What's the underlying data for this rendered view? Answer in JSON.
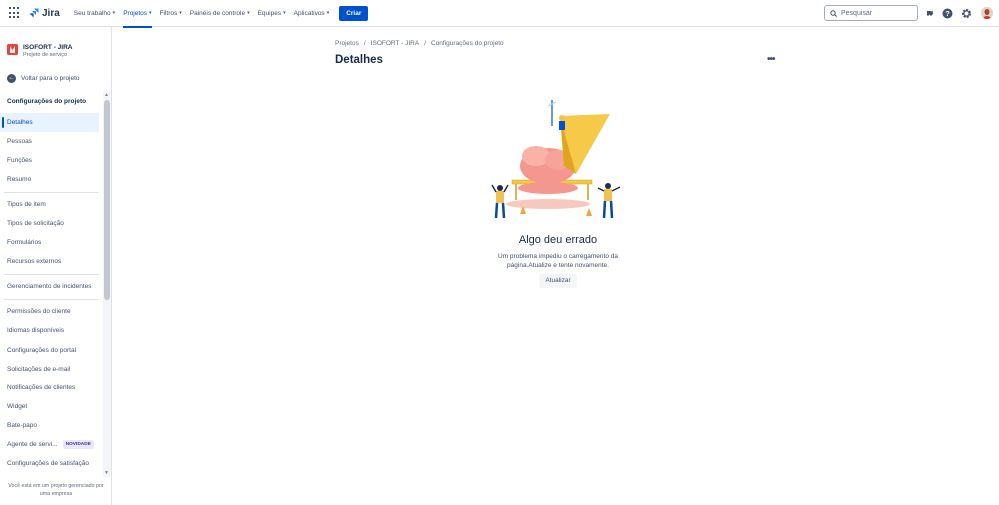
{
  "topnav": {
    "logo_text": "Jira",
    "items": [
      {
        "label": "Seu trabalho"
      },
      {
        "label": "Projetos"
      },
      {
        "label": "Filtros"
      },
      {
        "label": "Painéis de controle"
      },
      {
        "label": "Equipes"
      },
      {
        "label": "Aplicativos"
      }
    ],
    "active_item": "Projetos",
    "create_label": "Criar",
    "search_placeholder": "Pesquisar",
    "icons": [
      "notifications-icon",
      "help-icon",
      "settings-icon"
    ],
    "accent_color": "#0052cc"
  },
  "sidebar": {
    "project_name": "ISOFORT - JIRA",
    "project_type": "Projeto de serviço",
    "back_label": "Voltar para o projeto",
    "section_title": "Configurações do projeto",
    "groups": [
      [
        "Detalhes",
        "Pessoas",
        "Funções",
        "Resumo"
      ],
      [
        "Tipos de item",
        "Tipos de solicitação",
        "Formulários",
        "Recursos externos"
      ],
      [
        "Gerenciamento de incidentes"
      ],
      [
        "Permissões do cliente",
        "Idiomas disponíveis",
        "Configurações do portal",
        "Solicitações de e-mail",
        "Notificações de clientes",
        "Widget",
        "Bate-papo",
        "Agente de servi...",
        "Configurações de satisfação"
      ]
    ],
    "active_item": "Detalhes",
    "new_badge": "NOVIDADE",
    "footer_line1": "Você está em um projeto gerenciado por",
    "footer_line2": "uma empresa"
  },
  "breadcrumbs": [
    "Projetos",
    "ISOFORT - JIRA",
    "Configurações do projeto"
  ],
  "breadcrumb_separator": "/",
  "page_title": "Detalhes",
  "more_label": "•••",
  "error": {
    "title": "Algo deu errado",
    "message_line1": "Um problema impediu o carregamento da",
    "message_line2": "página.Atualize e tente novamente.",
    "button_label": "Atualizar"
  }
}
